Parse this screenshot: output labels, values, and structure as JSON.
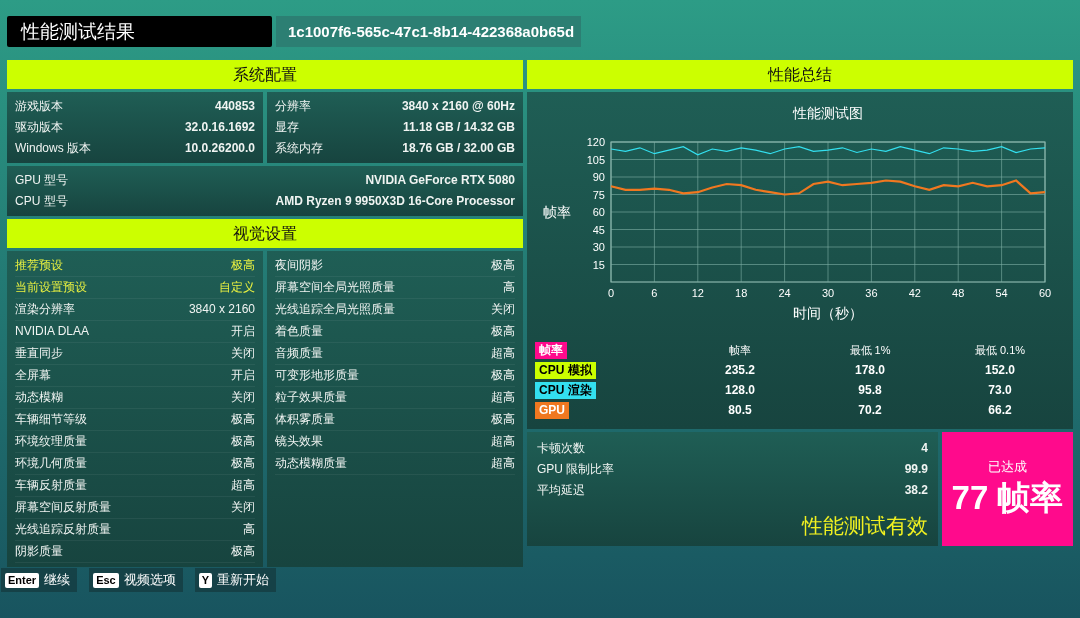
{
  "header": {
    "title": "性能测试结果",
    "run_id": "1c1007f6-565c-47c1-8b14-422368a0b65d"
  },
  "system_config": {
    "title": "系统配置",
    "left": [
      {
        "label": "游戏版本",
        "value": "440853"
      },
      {
        "label": "驱动版本",
        "value": "32.0.16.1692"
      },
      {
        "label": "Windows 版本",
        "value": "10.0.26200.0"
      }
    ],
    "right": [
      {
        "label": "分辨率",
        "value": "3840 x 2160 @ 60Hz"
      },
      {
        "label": "显存",
        "value": "11.18 GB / 14.32 GB"
      },
      {
        "label": "系统内存",
        "value": "18.76 GB / 32.00 GB"
      }
    ],
    "hardware": [
      {
        "label": "GPU 型号",
        "value": "NVIDIA GeForce RTX 5080"
      },
      {
        "label": "CPU 型号",
        "value": "AMD Ryzen 9 9950X3D 16-Core Processor"
      }
    ]
  },
  "visual_settings": {
    "title": "视觉设置",
    "left": [
      {
        "label": "推荐预设",
        "value": "极高",
        "highlighted": true
      },
      {
        "label": "当前设置预设",
        "value": "自定义",
        "highlighted": true
      },
      {
        "label": "渲染分辨率",
        "value": "3840 x 2160",
        "highlighted": false
      },
      {
        "label": "NVIDIA DLAA",
        "value": "开启",
        "highlighted": false
      },
      {
        "label": "垂直同步",
        "value": "关闭",
        "highlighted": false
      },
      {
        "label": "全屏幕",
        "value": "开启",
        "highlighted": false
      },
      {
        "label": "动态模糊",
        "value": "关闭",
        "highlighted": false
      },
      {
        "label": "车辆细节等级",
        "value": "极高",
        "highlighted": false
      },
      {
        "label": "环境纹理质量",
        "value": "极高",
        "highlighted": false
      },
      {
        "label": "环境几何质量",
        "value": "极高",
        "highlighted": false
      },
      {
        "label": "车辆反射质量",
        "value": "超高",
        "highlighted": false
      },
      {
        "label": "屏幕空间反射质量",
        "value": "关闭",
        "highlighted": false
      },
      {
        "label": "光线追踪反射质量",
        "value": "高",
        "highlighted": false
      },
      {
        "label": "阴影质量",
        "value": "极高",
        "highlighted": false
      }
    ],
    "right": [
      {
        "label": "夜间阴影",
        "value": "极高"
      },
      {
        "label": "屏幕空间全局光照质量",
        "value": "高"
      },
      {
        "label": "光线追踪全局光照质量",
        "value": "关闭"
      },
      {
        "label": "着色质量",
        "value": "极高"
      },
      {
        "label": "音频质量",
        "value": "超高"
      },
      {
        "label": "可变形地形质量",
        "value": "极高"
      },
      {
        "label": "粒子效果质量",
        "value": "超高"
      },
      {
        "label": "体积雾质量",
        "value": "极高"
      },
      {
        "label": "镜头效果",
        "value": "超高"
      },
      {
        "label": "动态模糊质量",
        "value": "超高"
      }
    ]
  },
  "performance_summary": {
    "title": "性能总结",
    "chart_data": {
      "type": "line",
      "grid": true,
      "title": "性能测试图",
      "xlabel": "时间（秒）",
      "ylabel": "帧率",
      "x": [
        0,
        2,
        4,
        6,
        8,
        10,
        12,
        14,
        16,
        18,
        20,
        22,
        24,
        26,
        28,
        30,
        32,
        34,
        36,
        38,
        40,
        42,
        44,
        46,
        48,
        50,
        52,
        54,
        56,
        58,
        60
      ],
      "xlim": [
        0,
        60
      ],
      "ylim": [
        0,
        120
      ],
      "xticks": [
        0,
        6,
        12,
        18,
        24,
        30,
        36,
        42,
        48,
        54,
        60
      ],
      "yticks": [
        15,
        30,
        45,
        60,
        75,
        90,
        105,
        120
      ],
      "series": [
        {
          "name": "CPU 渲染",
          "color": "#33e0f0",
          "values": [
            114,
            112,
            115,
            110,
            113,
            116,
            109,
            114,
            112,
            115,
            113,
            110,
            114,
            116,
            112,
            113,
            115,
            111,
            114,
            112,
            116,
            113,
            110,
            115,
            114,
            112,
            113,
            116,
            111,
            114,
            115
          ]
        },
        {
          "name": "GPU",
          "color": "#f07820",
          "values": [
            82,
            79,
            79,
            80,
            79,
            76,
            77,
            81,
            84,
            83,
            79,
            77,
            75,
            76,
            84,
            86,
            83,
            84,
            85,
            87,
            86,
            82,
            79,
            83,
            82,
            85,
            82,
            83,
            87,
            76,
            77
          ]
        }
      ]
    },
    "table": {
      "legend": {
        "label": "帧率",
        "color": "#ff0a8c"
      },
      "columns": [
        "帧率",
        "最低 1%",
        "最低 0.1%"
      ],
      "rows": [
        {
          "kind": "own",
          "label": "CPU 模拟",
          "color": "#ccff00",
          "values": [
            "235.2",
            "178.0",
            "152.0"
          ]
        },
        {
          "kind": "series",
          "values": [
            "128.0",
            "95.8",
            "73.0"
          ]
        },
        {
          "kind": "series",
          "values": [
            "80.5",
            "70.2",
            "66.2"
          ]
        }
      ]
    },
    "stats": [
      {
        "label": "卡顿次数",
        "value": "4"
      },
      {
        "label": "GPU 限制比率",
        "value": "99.9"
      },
      {
        "label": "平均延迟",
        "value": "38.2"
      }
    ],
    "status": "性能测试有效",
    "achievement": {
      "caption": "已达成",
      "value": "77 帧率"
    }
  },
  "footer": {
    "buttons": [
      {
        "key": "Enter",
        "label": "继续"
      },
      {
        "key": "Esc",
        "label": "视频选项"
      },
      {
        "key": "Y",
        "label": "重新开始"
      }
    ]
  }
}
